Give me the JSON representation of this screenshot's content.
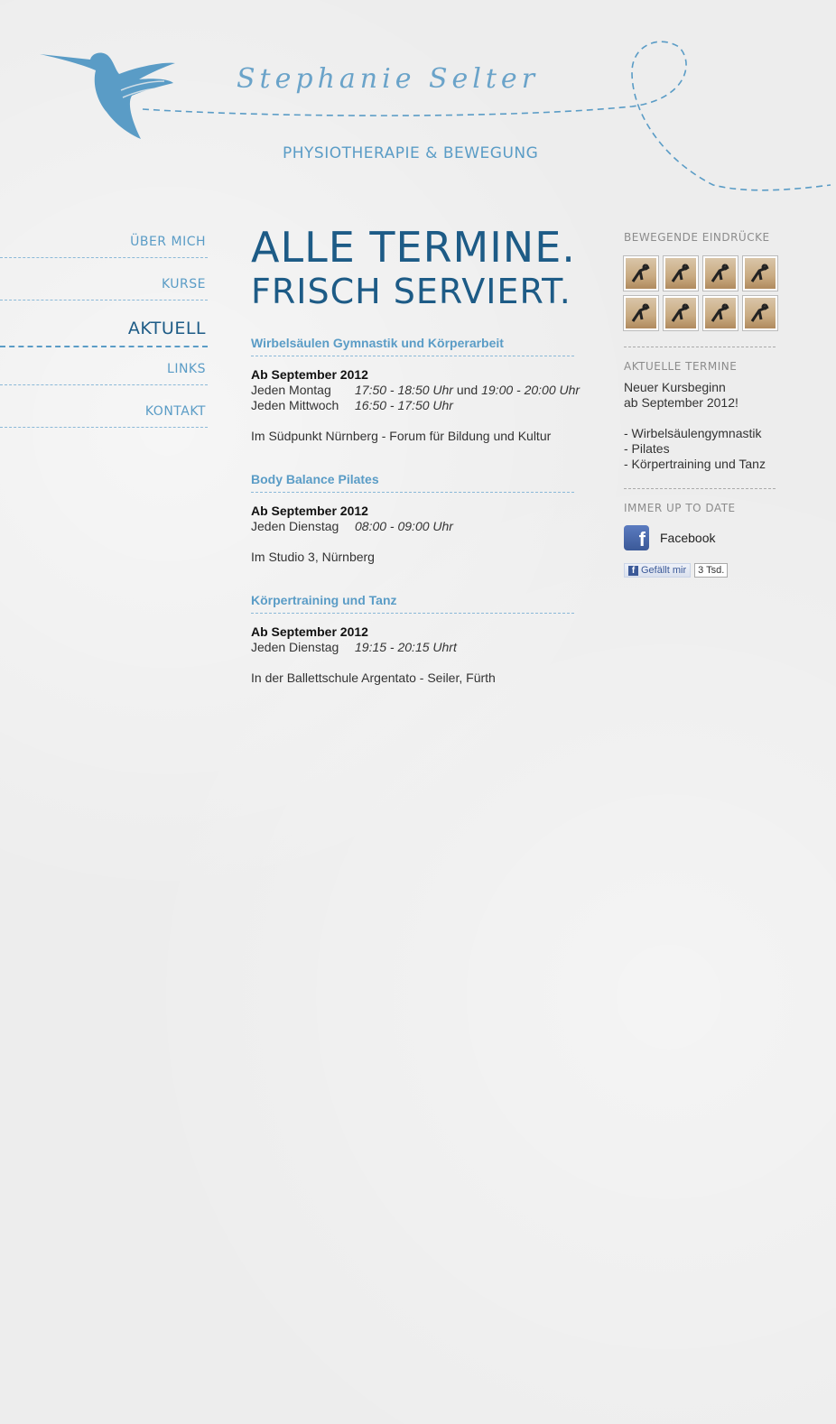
{
  "header": {
    "signature": "Stephanie Selter",
    "tagline": "PHYSIOTHERAPIE & BEWEGUNG"
  },
  "nav": {
    "items": [
      {
        "label": "ÜBER MICH"
      },
      {
        "label": "KURSE"
      },
      {
        "label": "AKTUELL",
        "active": true
      },
      {
        "label": "LINKS"
      },
      {
        "label": "KONTAKT"
      }
    ]
  },
  "main": {
    "headline_1": "ALLE TERMINE.",
    "headline_2": "FRISCH SERVIERT.",
    "courses": [
      {
        "title": "Wirbelsäulen Gymnastik und Körperarbeit",
        "start": "Ab September 2012",
        "rows": [
          {
            "day": "Jeden Montag",
            "time": "17:50 - 18:50 Uhr",
            "connector": " und ",
            "time2": "19:00 - 20:00 Uhr"
          },
          {
            "day": "Jeden Mittwoch",
            "time": "16:50 - 17:50 Uhr"
          }
        ],
        "location": "Im Südpunkt Nürnberg - Forum für Bildung und Kultur"
      },
      {
        "title": "Body Balance Pilates",
        "start": "Ab September 2012",
        "rows": [
          {
            "day": "Jeden Dienstag",
            "time": "08:00 - 09:00 Uhr"
          }
        ],
        "location": "Im Studio 3, Nürnberg"
      },
      {
        "title": "Körpertraining und Tanz",
        "start": "Ab September 2012",
        "rows": [
          {
            "day": "Jeden Dienstag",
            "time": "19:15 - 20:15 Uhrt"
          }
        ],
        "location": "In der Ballettschule Argentato - Seiler, Fürth"
      }
    ]
  },
  "sidebar": {
    "impressions_heading": "BEWEGENDE EINDRÜCKE",
    "termine_heading": "AKTUELLE TERMINE",
    "termine_line1": "Neuer Kursbeginn",
    "termine_line2": "ab September 2012!",
    "termine_list": [
      "- Wirbelsäulengymnastik",
      "- Pilates",
      "- Körpertraining und Tanz"
    ],
    "uptodate_heading": "IMMER UP TO DATE",
    "facebook_label": "Facebook",
    "like_label": "Gefällt mir",
    "like_count": "3 Tsd."
  },
  "colors": {
    "accent": "#5a9cc6",
    "accent_dark": "#1d5b86",
    "background": "#ededed"
  },
  "icons": {
    "bird": "hummingbird-logo",
    "facebook": "facebook-icon"
  }
}
